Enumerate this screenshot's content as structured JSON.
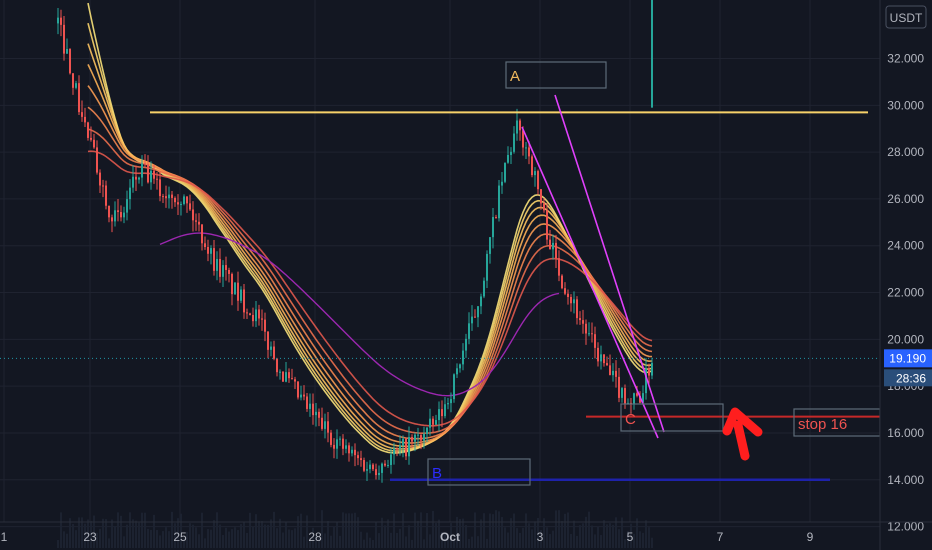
{
  "chart_data": {
    "type": "candlestick",
    "currency": "USDT",
    "ylim": [
      11000,
      34500
    ],
    "y_ticks": [
      "12.000",
      "14.000",
      "16.000",
      "18.000",
      "20.000",
      "22.000",
      "24.000",
      "26.000",
      "28.000",
      "30.000",
      "32.000"
    ],
    "y_tick_values": [
      12000,
      14000,
      16000,
      18000,
      20000,
      22000,
      24000,
      26000,
      28000,
      30000,
      32000
    ],
    "x_ticks": [
      "1",
      "23",
      "25",
      "28",
      "Oct",
      "3",
      "5",
      "7",
      "9"
    ],
    "last_price": "19.190",
    "countdown": "28:36",
    "close_series": [
      33500,
      32000,
      30000,
      28500,
      27000,
      25500,
      25000,
      26500,
      27200,
      26800,
      26200,
      26400,
      26000,
      25200,
      24300,
      23300,
      22800,
      22000,
      21500,
      21000,
      20000,
      19000,
      18200,
      17600,
      17000,
      16500,
      16000,
      15500,
      15100,
      14800,
      14500,
      14700,
      15000,
      15300,
      15600,
      15900,
      16300,
      17000,
      18200,
      19800,
      21000,
      23000,
      25500,
      27500,
      29000,
      28200,
      26500,
      24500,
      23000,
      22000,
      21000,
      20000,
      19200,
      18400,
      17800,
      17300,
      17700,
      19190
    ],
    "ema_ribbon_start": [
      35000,
      34000,
      33000,
      32000,
      31000,
      30000,
      29000,
      28000
    ],
    "annotations": {
      "labels": [
        "A",
        "B",
        "C"
      ],
      "stop_label": "stop 16",
      "resistance_level": 29700,
      "support_level": 14000,
      "stop_level": 16700
    },
    "colors": {
      "background": "#131722",
      "up": "#26a69a",
      "down": "#ef5350",
      "resistance": "#f7d26a",
      "support": "#1e22aa",
      "stop": "#c62828",
      "channel": "#e040fb",
      "arrow": "#ff1e1e",
      "ma": "#9c27b0",
      "label_a": "#f0b95e",
      "label_b": "#2c2cff",
      "label_c": "#ef5350",
      "price_tag": "#2962ff"
    }
  },
  "price_axis": {
    "currency": "USDT"
  }
}
